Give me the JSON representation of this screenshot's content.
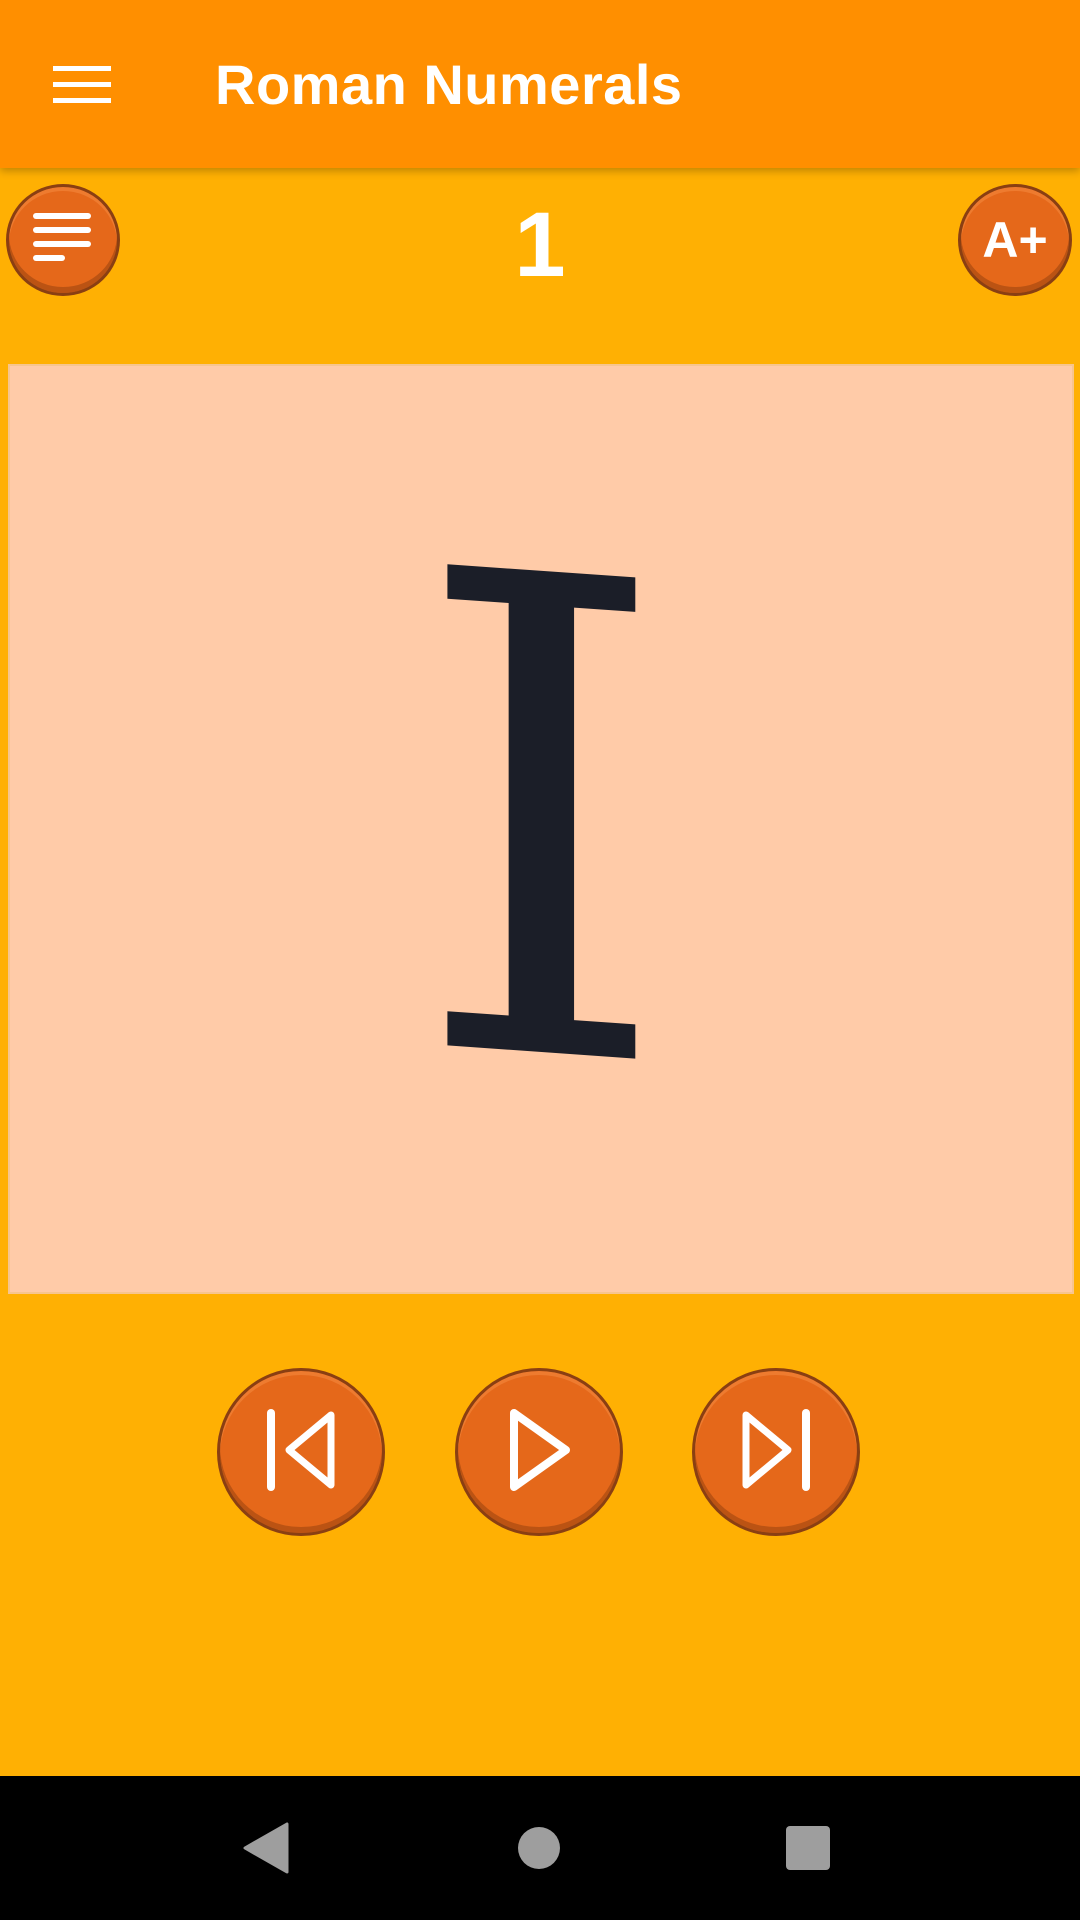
{
  "app_bar": {
    "title": "Roman Numerals",
    "menu_icon": "hamburger-menu-icon",
    "background": "#FF8F00"
  },
  "toolbar": {
    "list_icon": "list-icon",
    "counter": "1",
    "font_size_label": "A+"
  },
  "card": {
    "numeral": "I",
    "background": "#FFCBA8"
  },
  "controls": {
    "previous_icon": "skip-previous-icon",
    "play_icon": "play-icon",
    "next_icon": "skip-next-icon",
    "button_color": "#E5681A"
  },
  "system_nav": {
    "back_icon": "back-triangle-icon",
    "home_icon": "home-circle-icon",
    "recents_icon": "recents-square-icon"
  },
  "colors": {
    "page_background": "#FFB003"
  }
}
